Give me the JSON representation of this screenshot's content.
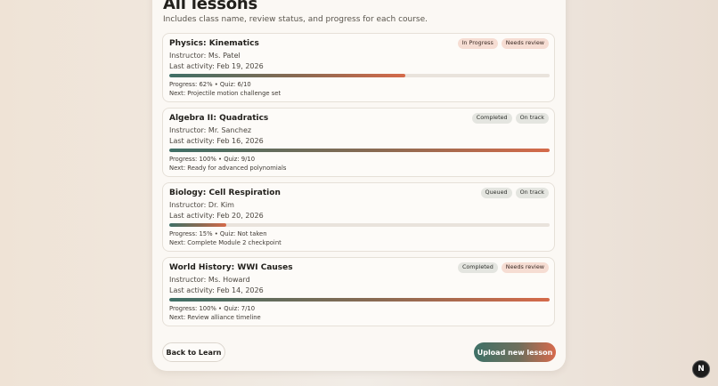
{
  "header": {
    "title": "All lessons",
    "subtitle": "Includes class name, review status, and progress for each course."
  },
  "lessons": [
    {
      "title": "Physics: Kinematics",
      "instructor": "Instructor: Ms. Patel",
      "activity": "Last activity: Feb 19, 2026",
      "badges": [
        "In Progress",
        "Needs review"
      ],
      "progress": 62,
      "progress_text": "Progress: 62% • Quiz: 6/10",
      "next": "Next: Projectile motion challenge set"
    },
    {
      "title": "Algebra II: Quadratics",
      "instructor": "Instructor: Mr. Sanchez",
      "activity": "Last activity: Feb 16, 2026",
      "badges": [
        "Completed",
        "On track"
      ],
      "progress": 100,
      "progress_text": "Progress: 100% • Quiz: 9/10",
      "next": "Next: Ready for advanced polynomials"
    },
    {
      "title": "Biology: Cell Respiration",
      "instructor": "Instructor: Dr. Kim",
      "activity": "Last activity: Feb 20, 2026",
      "badges": [
        "Queued",
        "On track"
      ],
      "progress": 15,
      "progress_text": "Progress: 15% • Quiz: Not taken",
      "next": "Next: Complete Module 2 checkpoint"
    },
    {
      "title": "World History: WWI Causes",
      "instructor": "Instructor: Ms. Howard",
      "activity": "Last activity: Feb 14, 2026",
      "badges": [
        "Completed",
        "Needs review"
      ],
      "progress": 100,
      "progress_text": "Progress: 100% • Quiz: 7/10",
      "next": "Next: Review alliance timeline"
    }
  ],
  "actions": {
    "back_label": "Back to Learn",
    "upload_label": "Upload new lesson"
  },
  "fab": {
    "label": "N",
    "icon": "n-logo-icon"
  },
  "colors": {
    "accent_start": "#3e7167",
    "accent_end": "#d76a4c",
    "warm_badge": "#f6ddd3",
    "cool_badge": "#e4e5e0"
  }
}
